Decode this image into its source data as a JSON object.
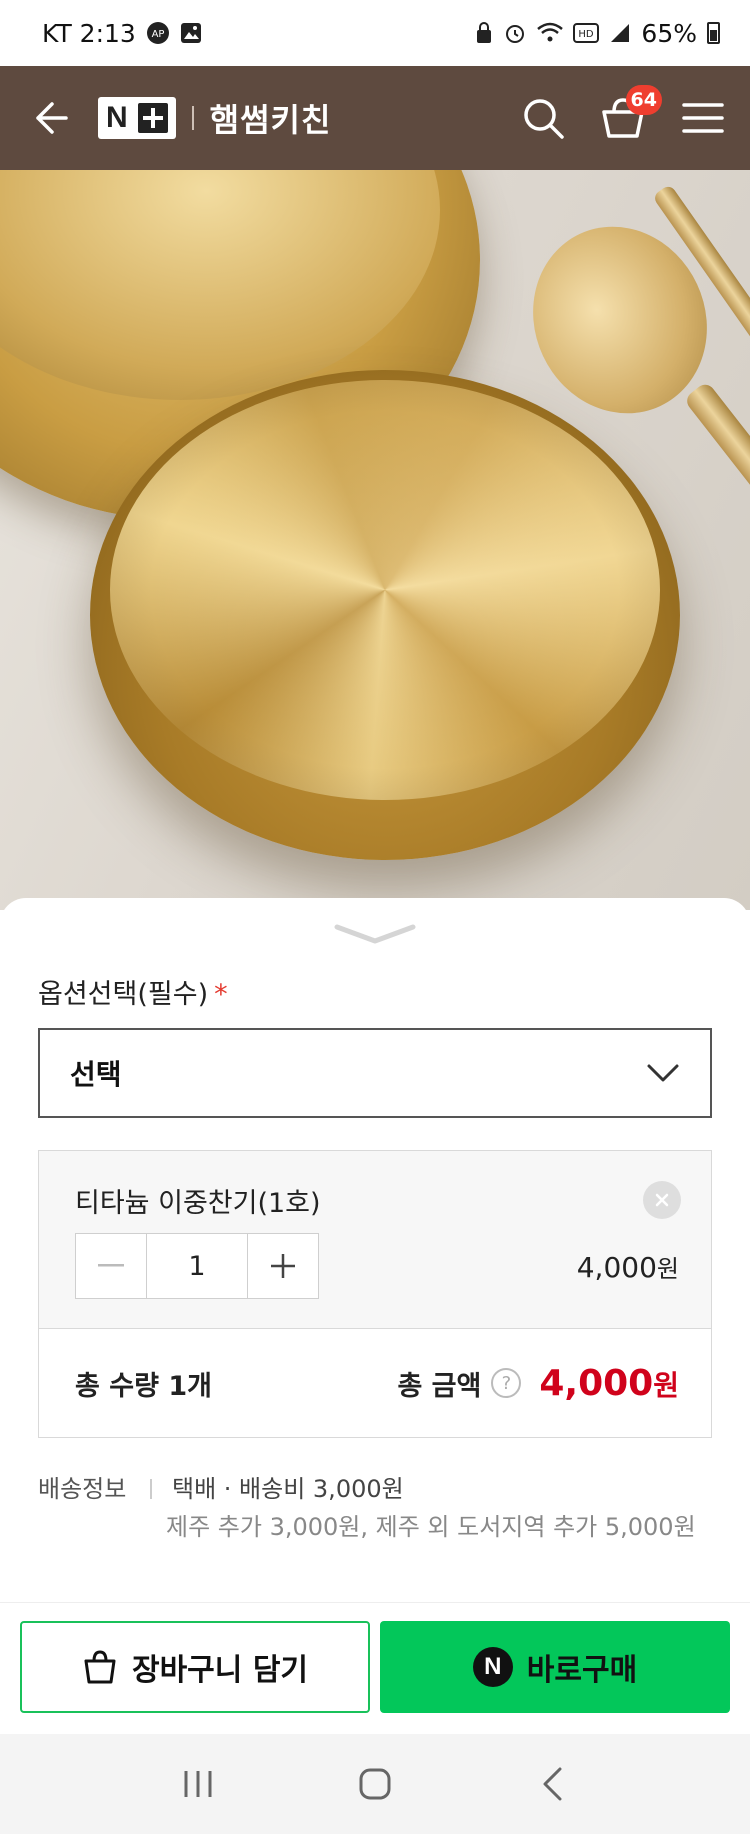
{
  "status": {
    "carrier_time": "KT 2:13",
    "battery": "65%"
  },
  "header": {
    "logo_text": "N",
    "store_name": "햄썸키친",
    "cart_count": "64"
  },
  "gallery": {
    "slide_count": 7,
    "active_index": 0
  },
  "option": {
    "label": "옵션선택(필수)",
    "required_mark": "*",
    "select_value": "선택"
  },
  "item": {
    "name": "티타늄 이중찬기(1호)",
    "quantity": "1",
    "price": "4,000",
    "price_unit": "원"
  },
  "totals": {
    "quantity_label": "총 수량 1개",
    "amount_label": "총 금액",
    "help": "?",
    "amount": "4,000",
    "amount_unit": "원"
  },
  "shipping": {
    "title": "배송정보",
    "line1": "택배 · 배송비 3,000원",
    "line2": "제주 추가 3,000원, 제주 외 도서지역 추가 5,000원"
  },
  "actions": {
    "cart_label": "장바구니 담기",
    "buy_label": "바로구매",
    "buy_badge": "N"
  },
  "colors": {
    "header_bg": "#5e4a3f",
    "buy_green": "#03c75a",
    "price_red": "#d0021b",
    "badge_red": "#ef3e2f"
  },
  "icons": {
    "back": "arrow-left-icon",
    "search": "search-icon",
    "cart": "basket-icon",
    "menu": "hamburger-icon",
    "expand": "expand-icon",
    "chevron": "chevron-down-icon",
    "remove": "close-icon"
  }
}
